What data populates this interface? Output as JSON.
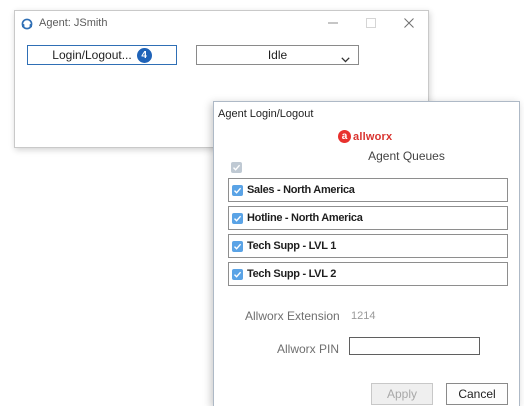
{
  "main_window": {
    "title": "Agent: JSmith",
    "login_button": {
      "label": "Login/Logout...",
      "badge": "4"
    },
    "status_select": {
      "value": "Idle"
    }
  },
  "dialog": {
    "title": "Agent Login/Logout",
    "logo_mark": "a",
    "logo_text": "allworx",
    "section_label": "Agent Queues",
    "queues": [
      {
        "label": "Sales - North America",
        "checked": true
      },
      {
        "label": "Hotline - North America",
        "checked": true
      },
      {
        "label": "Tech Supp - LVL 1",
        "checked": true
      },
      {
        "label": "Tech Supp - LVL 2",
        "checked": true
      }
    ],
    "extension_label": "Allworx Extension",
    "extension_value": "1214",
    "pin_label": "Allworx PIN",
    "pin_value": "",
    "apply_label": "Apply",
    "cancel_label": "Cancel"
  },
  "colors": {
    "accent": "#1f63b8",
    "checkbox": "#5aa3e6",
    "brand": "#e8312e"
  },
  "icons": {
    "app": "headset-icon",
    "minimize": "minimize-icon",
    "maximize": "maximize-icon",
    "close": "close-icon",
    "dropdown": "chevron-down-icon",
    "check": "checkmark-icon"
  }
}
